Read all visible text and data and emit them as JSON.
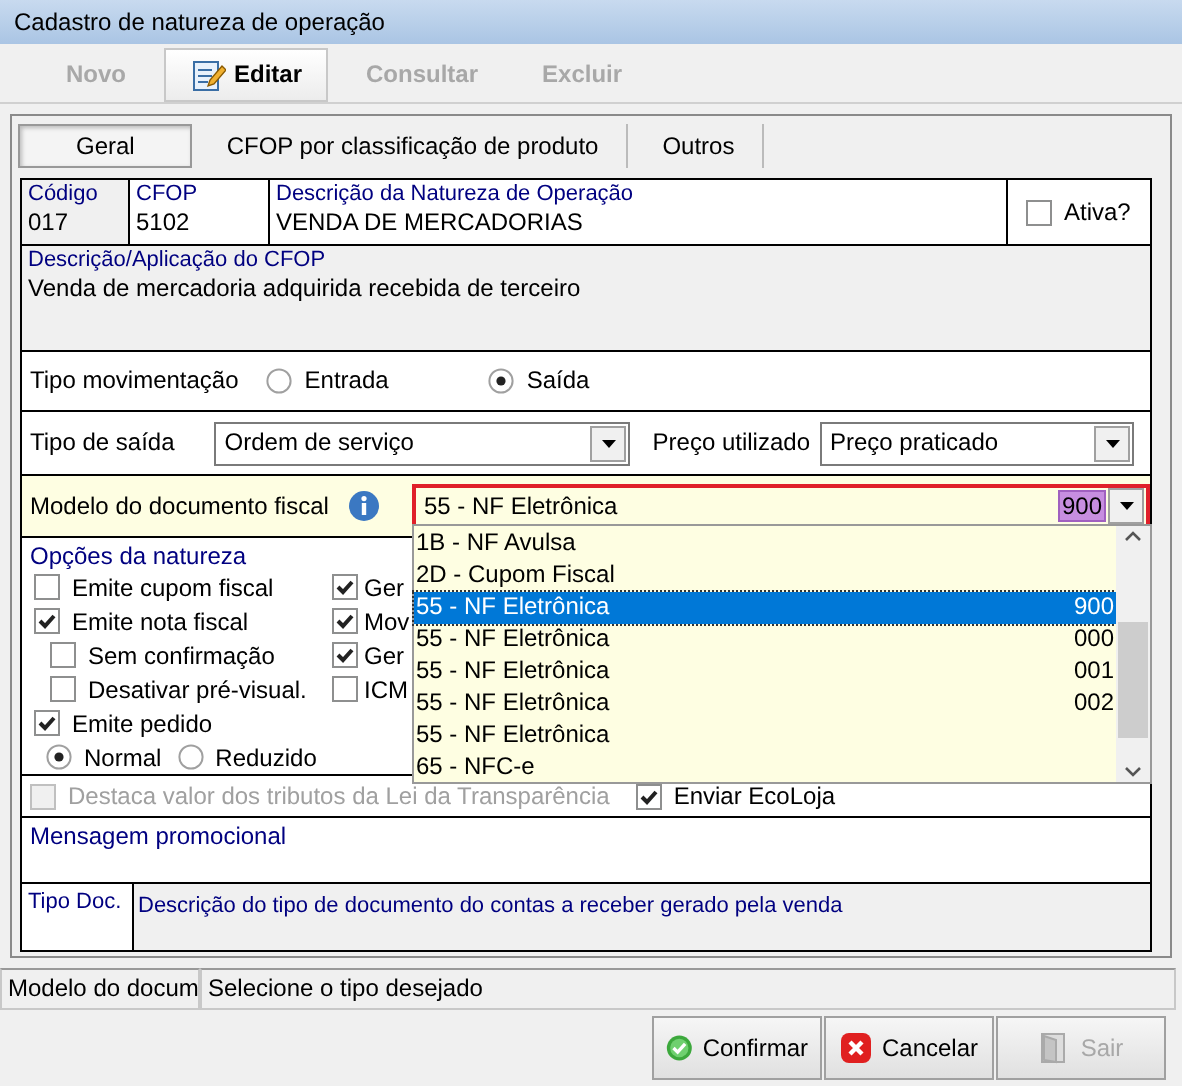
{
  "window": {
    "title": "Cadastro de natureza de operação"
  },
  "toolbar": [
    {
      "label": "Novo",
      "disabled": true,
      "selected": false
    },
    {
      "label": "Editar",
      "disabled": false,
      "selected": true
    },
    {
      "label": "Consultar",
      "disabled": true,
      "selected": false
    },
    {
      "label": "Excluir",
      "disabled": true,
      "selected": false
    }
  ],
  "tabs": [
    {
      "label": "Geral",
      "selected": true
    },
    {
      "label": "CFOP por classificação de produto",
      "selected": false
    },
    {
      "label": "Outros",
      "selected": false
    }
  ],
  "header": {
    "code_label": "Código",
    "code": "017",
    "cfop_label": "CFOP",
    "cfop": "5102",
    "description_label": "Descrição da Natureza de Operação",
    "description": "VENDA DE MERCADORIAS",
    "active": {
      "label": "Ativa?",
      "checked": false
    }
  },
  "cfop_application": {
    "label": "Descrição/Aplicação do CFOP",
    "value": "Venda de mercadoria adquirida recebida de terceiro"
  },
  "movement": {
    "label": "Tipo movimentação",
    "options": [
      {
        "label": "Entrada",
        "selected": false
      },
      {
        "label": "Saída",
        "selected": true
      }
    ]
  },
  "exit_type": {
    "label": "Tipo de saída",
    "value": "Ordem de serviço"
  },
  "price": {
    "label": "Preço utilizado",
    "value": "Preço praticado"
  },
  "fiscal_model": {
    "label": "Modelo do documento fiscal",
    "value": "55 - NF Eletrônica",
    "code": "900"
  },
  "fiscal_model_list": [
    {
      "label": "1B - NF Avulsa",
      "selected": false
    },
    {
      "label": "2D - Cupom Fiscal",
      "selected": false
    },
    {
      "label": "55 - NF Eletrônica",
      "code": "900",
      "selected": true
    },
    {
      "label": "55 - NF Eletrônica",
      "code": "000",
      "selected": false
    },
    {
      "label": "55 - NF Eletrônica",
      "code": "001",
      "selected": false
    },
    {
      "label": "55 - NF Eletrônica",
      "code": "002",
      "selected": false
    },
    {
      "label": "55 - NF Eletrônica",
      "selected": false
    },
    {
      "label": "65 - NFC-e",
      "selected": false
    }
  ],
  "options": {
    "title": "Opções da natureza",
    "left": [
      {
        "kind": "checkbox",
        "label": "Emite cupom fiscal",
        "checked": false
      },
      {
        "kind": "checkbox",
        "label": "Emite nota fiscal",
        "checked": true,
        "children": [
          {
            "kind": "checkbox",
            "label": "Sem confirmação",
            "checked": false
          },
          {
            "kind": "checkbox",
            "label": "Desativar pré-visual.",
            "checked": false
          }
        ]
      },
      {
        "kind": "checkbox",
        "label": "Emite pedido",
        "checked": true,
        "children": [
          {
            "kind": "radio",
            "label": "Normal",
            "checked": true
          },
          {
            "kind": "radio",
            "label": "Reduzido",
            "checked": false
          }
        ]
      }
    ],
    "right": [
      {
        "kind": "checkbox",
        "label": "Ger",
        "checked": true
      },
      {
        "kind": "checkbox",
        "label": "Mov",
        "checked": true
      },
      {
        "kind": "checkbox",
        "label": "Ger",
        "checked": true
      },
      {
        "kind": "checkbox",
        "label": "ICM",
        "checked": false
      }
    ]
  },
  "transparency": {
    "label": "Destaca valor dos tributos da Lei da Transparência",
    "checked": false,
    "disabled": true
  },
  "ecoloja": {
    "label": "Enviar EcoLoja",
    "checked": true
  },
  "promo": {
    "label": "Mensagem promocional"
  },
  "doc_type": {
    "label": "Tipo Doc.",
    "description": "Descrição do tipo de documento do contas a receber gerado pela venda"
  },
  "status_bar": [
    "Modelo do docum",
    "Selecione o tipo desejado"
  ],
  "buttons": [
    {
      "label": "Confirmar",
      "disabled": false
    },
    {
      "label": "Cancelar",
      "disabled": false
    },
    {
      "label": "Sair",
      "disabled": true
    }
  ]
}
